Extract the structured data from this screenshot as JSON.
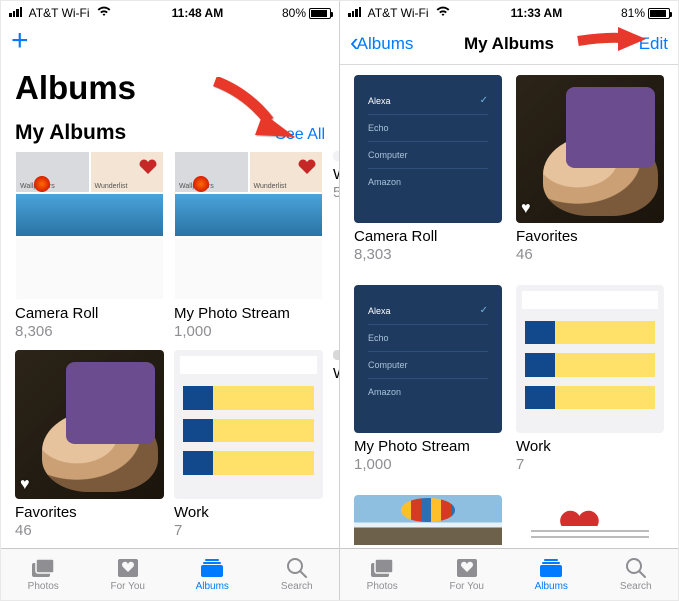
{
  "left": {
    "status": {
      "carrier": "AT&T Wi-Fi",
      "time": "11:48 AM",
      "battery": "80%"
    },
    "add_label": "+",
    "big_title": "Albums",
    "section_title": "My Albums",
    "see_all_label": "See All",
    "albums_row1": [
      {
        "name": "Camera Roll",
        "count": "8,306"
      },
      {
        "name": "My Photo Stream",
        "count": "1,000"
      },
      {
        "name": "W",
        "count": "5"
      }
    ],
    "albums_row2": [
      {
        "name": "Favorites",
        "count": "46"
      },
      {
        "name": "Work",
        "count": "7"
      },
      {
        "name": "W",
        "count": ""
      }
    ]
  },
  "right": {
    "status": {
      "carrier": "AT&T Wi-Fi",
      "time": "11:33 AM",
      "battery": "81%"
    },
    "back_label": "Albums",
    "nav_title": "My Albums",
    "edit_label": "Edit",
    "list_items": [
      "Alexa",
      "Echo",
      "Computer",
      "Amazon"
    ],
    "albums": [
      {
        "name": "Camera Roll",
        "count": "8,303"
      },
      {
        "name": "Favorites",
        "count": "46"
      },
      {
        "name": "My Photo Stream",
        "count": "1,000"
      },
      {
        "name": "Work",
        "count": "7"
      }
    ]
  },
  "tabs": {
    "photos": "Photos",
    "foryou": "For You",
    "albums": "Albums",
    "search": "Search"
  }
}
